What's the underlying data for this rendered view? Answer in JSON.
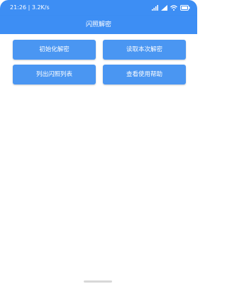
{
  "status_bar": {
    "time": "21:26 | 3.2K/s",
    "icons": [
      "alarm-icon",
      "sim-signal-icon",
      "cell-signal-icon",
      "wifi-icon",
      "battery-icon"
    ],
    "battery_label": ""
  },
  "app_bar": {
    "title": "闪照解密"
  },
  "buttons": [
    {
      "label": "初始化解密"
    },
    {
      "label": "读取本次解密"
    },
    {
      "label": "列出闪照列表"
    },
    {
      "label": "查看使用帮助"
    }
  ],
  "colors": {
    "primary": "#3d8ef4",
    "button": "#4a96f2",
    "background": "#ffffff"
  }
}
